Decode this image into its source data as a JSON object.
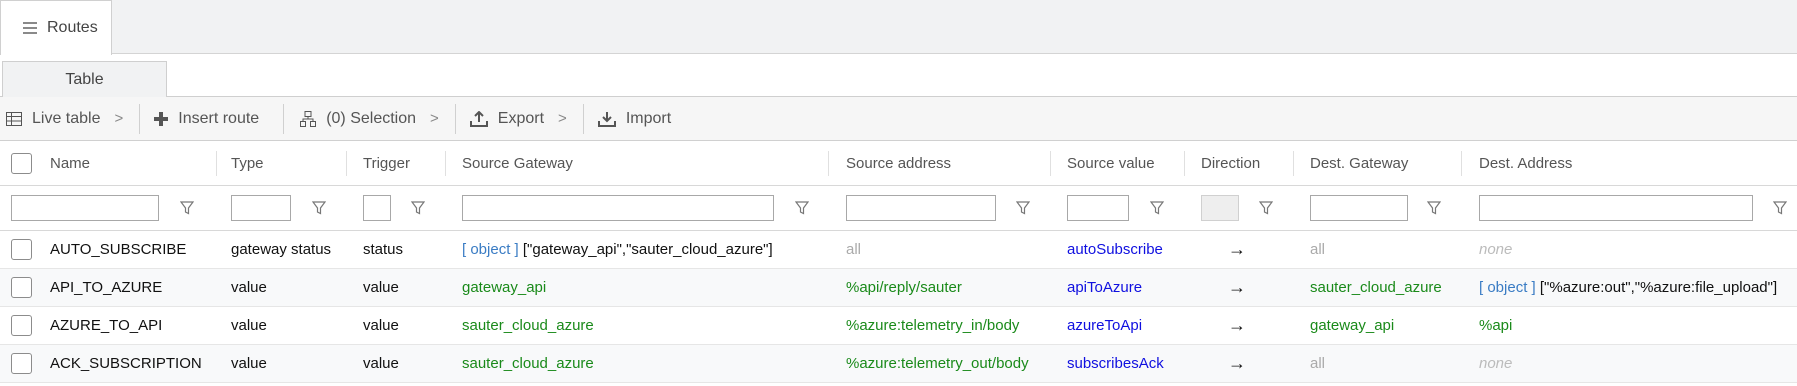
{
  "main_tab": {
    "label": "Routes"
  },
  "sub_tab": {
    "label": "Table"
  },
  "toolbar": {
    "live_table": "Live table",
    "insert_route": "Insert route",
    "selection": "(0) Selection",
    "export": "Export",
    "import": "Import"
  },
  "columns": [
    "Name",
    "Type",
    "Trigger",
    "Source Gateway",
    "Source address",
    "Source value",
    "Direction",
    "Dest. Gateway",
    "Dest. Address"
  ],
  "rows": [
    {
      "name": "AUTO_SUBSCRIBE",
      "type": "gateway status",
      "trigger": "status",
      "src_gw_obj": "[ object ]",
      "src_gw": "[\"gateway_api\",\"sauter_cloud_azure\"]",
      "src_addr": "all",
      "src_value": "autoSubscribe",
      "direction": "→",
      "dest_gw": "all",
      "dest_addr_obj": "",
      "dest_addr": "none"
    },
    {
      "name": "API_TO_AZURE",
      "type": "value",
      "trigger": "value",
      "src_gw_obj": "",
      "src_gw": "gateway_api",
      "src_addr": "%api/reply/sauter",
      "src_value": "apiToAzure",
      "direction": "→",
      "dest_gw": "sauter_cloud_azure",
      "dest_addr_obj": "[ object ]",
      "dest_addr": "[\"%azure:out\",\"%azure:file_upload\"]"
    },
    {
      "name": "AZURE_TO_API",
      "type": "value",
      "trigger": "value",
      "src_gw_obj": "",
      "src_gw": "sauter_cloud_azure",
      "src_addr": "%azure:telemetry_in/body",
      "src_value": "azureToApi",
      "direction": "→",
      "dest_gw": "gateway_api",
      "dest_addr_obj": "",
      "dest_addr": "%api"
    },
    {
      "name": "ACK_SUBSCRIPTION",
      "type": "value",
      "trigger": "value",
      "src_gw_obj": "",
      "src_gw": "sauter_cloud_azure",
      "src_addr": "%azure:telemetry_out/body",
      "src_value": "subscribesAck",
      "direction": "→",
      "dest_gw": "all",
      "dest_addr_obj": "",
      "dest_addr": "none"
    }
  ],
  "colors": {
    "green_text": "#1a8a1a",
    "blue_text": "#1010e0",
    "object_link": "#3a7cc4",
    "muted": "#aaaaaa"
  }
}
